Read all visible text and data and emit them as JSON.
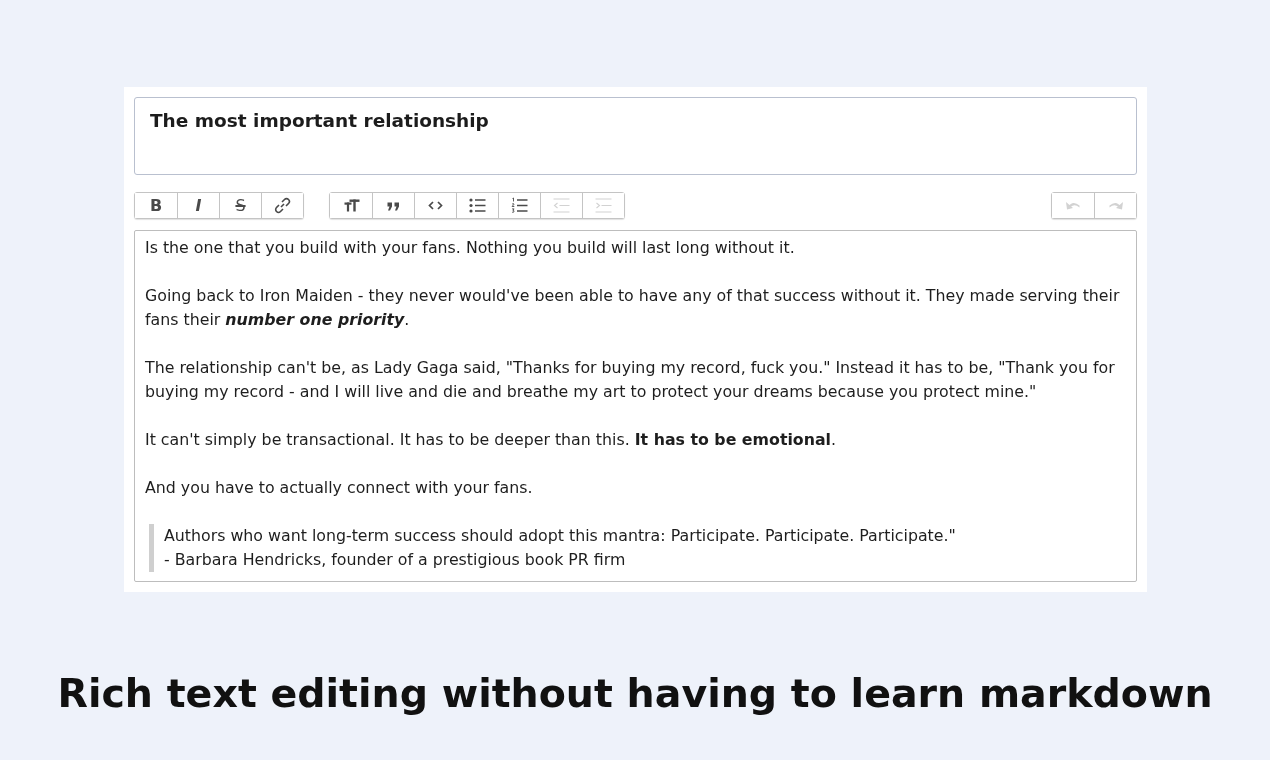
{
  "editor": {
    "title_field": {
      "value": "The most important relationship"
    },
    "toolbar": {
      "left_groups": [
        {
          "buttons": [
            {
              "kind": "bold",
              "label": "B",
              "disabled": false
            },
            {
              "kind": "italic",
              "label": "I",
              "disabled": false
            },
            {
              "kind": "strikethrough",
              "label": "S",
              "disabled": false
            },
            {
              "kind": "link",
              "disabled": false
            }
          ]
        },
        {
          "buttons": [
            {
              "kind": "heading",
              "disabled": false
            },
            {
              "kind": "quote",
              "disabled": false
            },
            {
              "kind": "code",
              "disabled": false
            },
            {
              "kind": "bullet-list",
              "disabled": false
            },
            {
              "kind": "numbered-list",
              "disabled": false
            },
            {
              "kind": "outdent",
              "disabled": true
            },
            {
              "kind": "indent",
              "disabled": true
            }
          ]
        }
      ],
      "right_groups": [
        {
          "buttons": [
            {
              "kind": "undo",
              "disabled": true
            },
            {
              "kind": "redo",
              "disabled": true
            }
          ]
        }
      ]
    },
    "body": [
      {
        "kind": "paragraph",
        "runs": [
          {
            "kind": "plain",
            "text": "Is the one that you build with your fans. Nothing you build will last long without it."
          }
        ]
      },
      {
        "kind": "paragraph",
        "runs": [
          {
            "kind": "plain",
            "text": "Going back to Iron Maiden - they never would've been able to have any of that success without it. They made serving their fans their "
          },
          {
            "kind": "bolditalic",
            "text": "number one priority"
          },
          {
            "kind": "plain",
            "text": "."
          }
        ]
      },
      {
        "kind": "paragraph",
        "runs": [
          {
            "kind": "plain",
            "text": "The relationship can't be, as Lady Gaga said, \"Thanks for buying my record, fuck you.\" Instead it has to be, \"Thank you for buying my record - and I will live and die and breathe my art to protect your dreams because you protect mine.\""
          }
        ]
      },
      {
        "kind": "paragraph",
        "runs": [
          {
            "kind": "plain",
            "text": "It can't simply be transactional. It has to be deeper than this. "
          },
          {
            "kind": "bold",
            "text": "It has to be emotional"
          },
          {
            "kind": "plain",
            "text": "."
          }
        ]
      },
      {
        "kind": "paragraph",
        "runs": [
          {
            "kind": "plain",
            "text": "And you have to actually connect with your fans."
          }
        ]
      },
      {
        "kind": "quote",
        "lines": [
          "Authors who want long-term success should adopt this mantra: Participate. Participate. Participate.\"",
          "- Barbara Hendricks, founder of a prestigious book PR firm"
        ]
      }
    ]
  },
  "caption": "Rich text editing without having to learn markdown"
}
